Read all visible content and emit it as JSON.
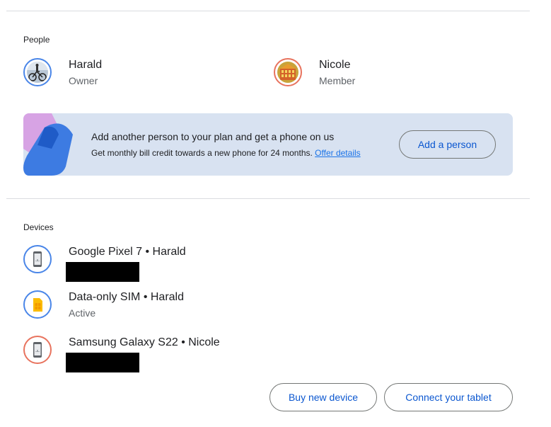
{
  "people": {
    "title": "People",
    "members": [
      {
        "name": "Harald",
        "role": "Owner",
        "avatar_icon": "person-with-bicycle-photo",
        "ring_color": "#4a86e8"
      },
      {
        "name": "Nicole",
        "role": "Member",
        "avatar_icon": "building-photo",
        "ring_color": "#e8735e"
      }
    ]
  },
  "promo": {
    "headline": "Add another person to your plan and get a phone on us",
    "subtext": "Get monthly bill credit towards a new phone for 24 months.",
    "link": "Offer details",
    "button": "Add a person"
  },
  "devices": {
    "title": "Devices",
    "items": [
      {
        "name": "Google Pixel 7 • Harald",
        "status": "",
        "icon": "android-phone-icon",
        "ring_color": "#4a86e8",
        "redacted": true
      },
      {
        "name": "Data-only SIM • Harald",
        "status": "Active",
        "icon": "sim-card-icon",
        "ring_color": "#4a86e8",
        "redacted": false
      },
      {
        "name": "Samsung Galaxy S22 • Nicole",
        "status": "",
        "icon": "android-phone-icon",
        "ring_color": "#e8735e",
        "redacted": true
      }
    ],
    "buy_button": "Buy new device",
    "tablet_button": "Connect your tablet"
  }
}
